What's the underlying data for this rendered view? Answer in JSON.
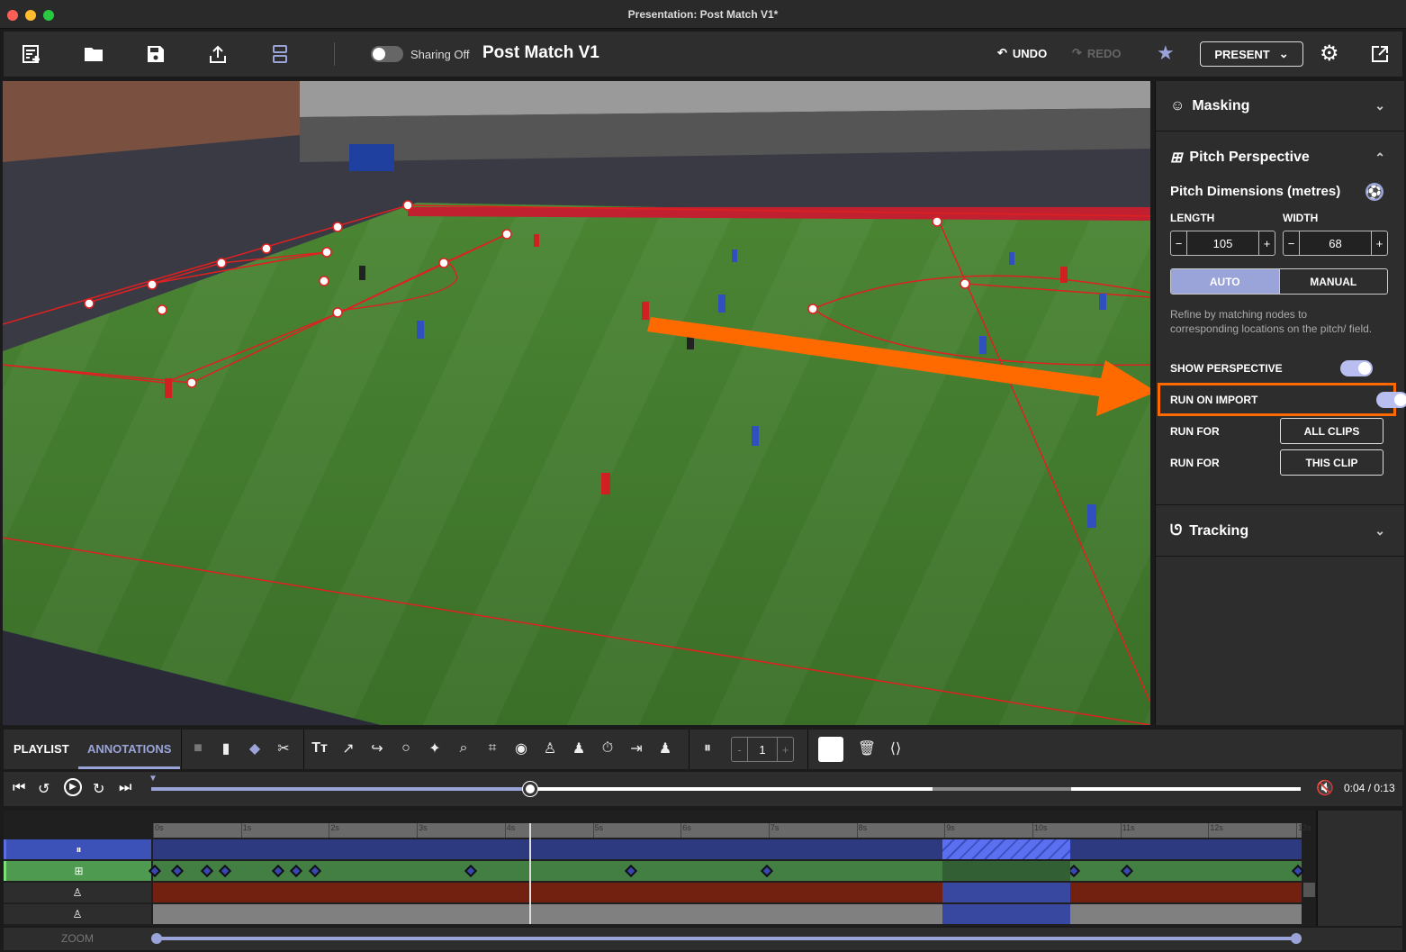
{
  "window": {
    "title": "Presentation: Post Match V1*"
  },
  "toolbar": {
    "icons": [
      "new-presentation-icon",
      "folder-icon",
      "save-icon",
      "export-icon",
      "layout-icon"
    ],
    "sharing_label": "Sharing Off",
    "sharing_on": false,
    "presentation_title": "Post Match V1",
    "undo_label": "UNDO",
    "redo_label": "REDO",
    "present_label": "PRESENT"
  },
  "panel": {
    "masking": {
      "title": "Masking",
      "expanded": false
    },
    "pitch_perspective": {
      "title": "Pitch Perspective",
      "expanded": true,
      "dimensions_title": "Pitch Dimensions (metres)",
      "length_label": "LENGTH",
      "length_value": "105",
      "width_label": "WIDTH",
      "width_value": "68",
      "modes": [
        "AUTO",
        "MANUAL"
      ],
      "active_mode": "AUTO",
      "help_text": "Refine by matching nodes to corresponding locations on the pitch/ field.",
      "show_perspective_label": "SHOW PERSPECTIVE",
      "show_perspective_on": true,
      "run_on_import_label": "RUN ON IMPORT",
      "run_on_import_on": true,
      "run_for_label_1": "RUN FOR",
      "all_clips_label": "ALL CLIPS",
      "run_for_label_2": "RUN FOR",
      "this_clip_label": "THIS CLIP"
    },
    "tracking": {
      "title": "Tracking",
      "expanded": false
    }
  },
  "bottom": {
    "tabs": [
      "PLAYLIST",
      "ANNOTATIONS"
    ],
    "active_tab": "ANNOTATIONS",
    "frame_value": "1",
    "stepper_minus": "-",
    "stepper_plus": "+"
  },
  "playback": {
    "progress": 0.33,
    "buffered_range": [
      0.68,
      0.8
    ],
    "time_display": "0:04 / 0:13",
    "muted": true
  },
  "timeline": {
    "ticks": [
      "0s",
      "1s",
      "2s",
      "3s",
      "4s",
      "5s",
      "6s",
      "7s",
      "8s",
      "9s",
      "10s",
      "11s",
      "12s",
      "13s"
    ],
    "playhead_seconds": 4.28,
    "highlight_range_seconds": [
      8.98,
      10.43
    ],
    "keyframes_seconds": [
      0.02,
      0.28,
      0.61,
      0.82,
      1.42,
      1.63,
      1.84,
      3.61,
      5.44,
      6.98,
      10.47,
      11.07,
      13.02
    ],
    "zoom_label": "ZOOM"
  },
  "colors": {
    "accent": "#9aa4d8",
    "highlight_orange": "#ff6a00",
    "track_blue": "#2d3a80",
    "track_green": "#437f42",
    "track_red": "#722010",
    "track_gray": "#808080",
    "pitch_line_red": "#e02020"
  }
}
